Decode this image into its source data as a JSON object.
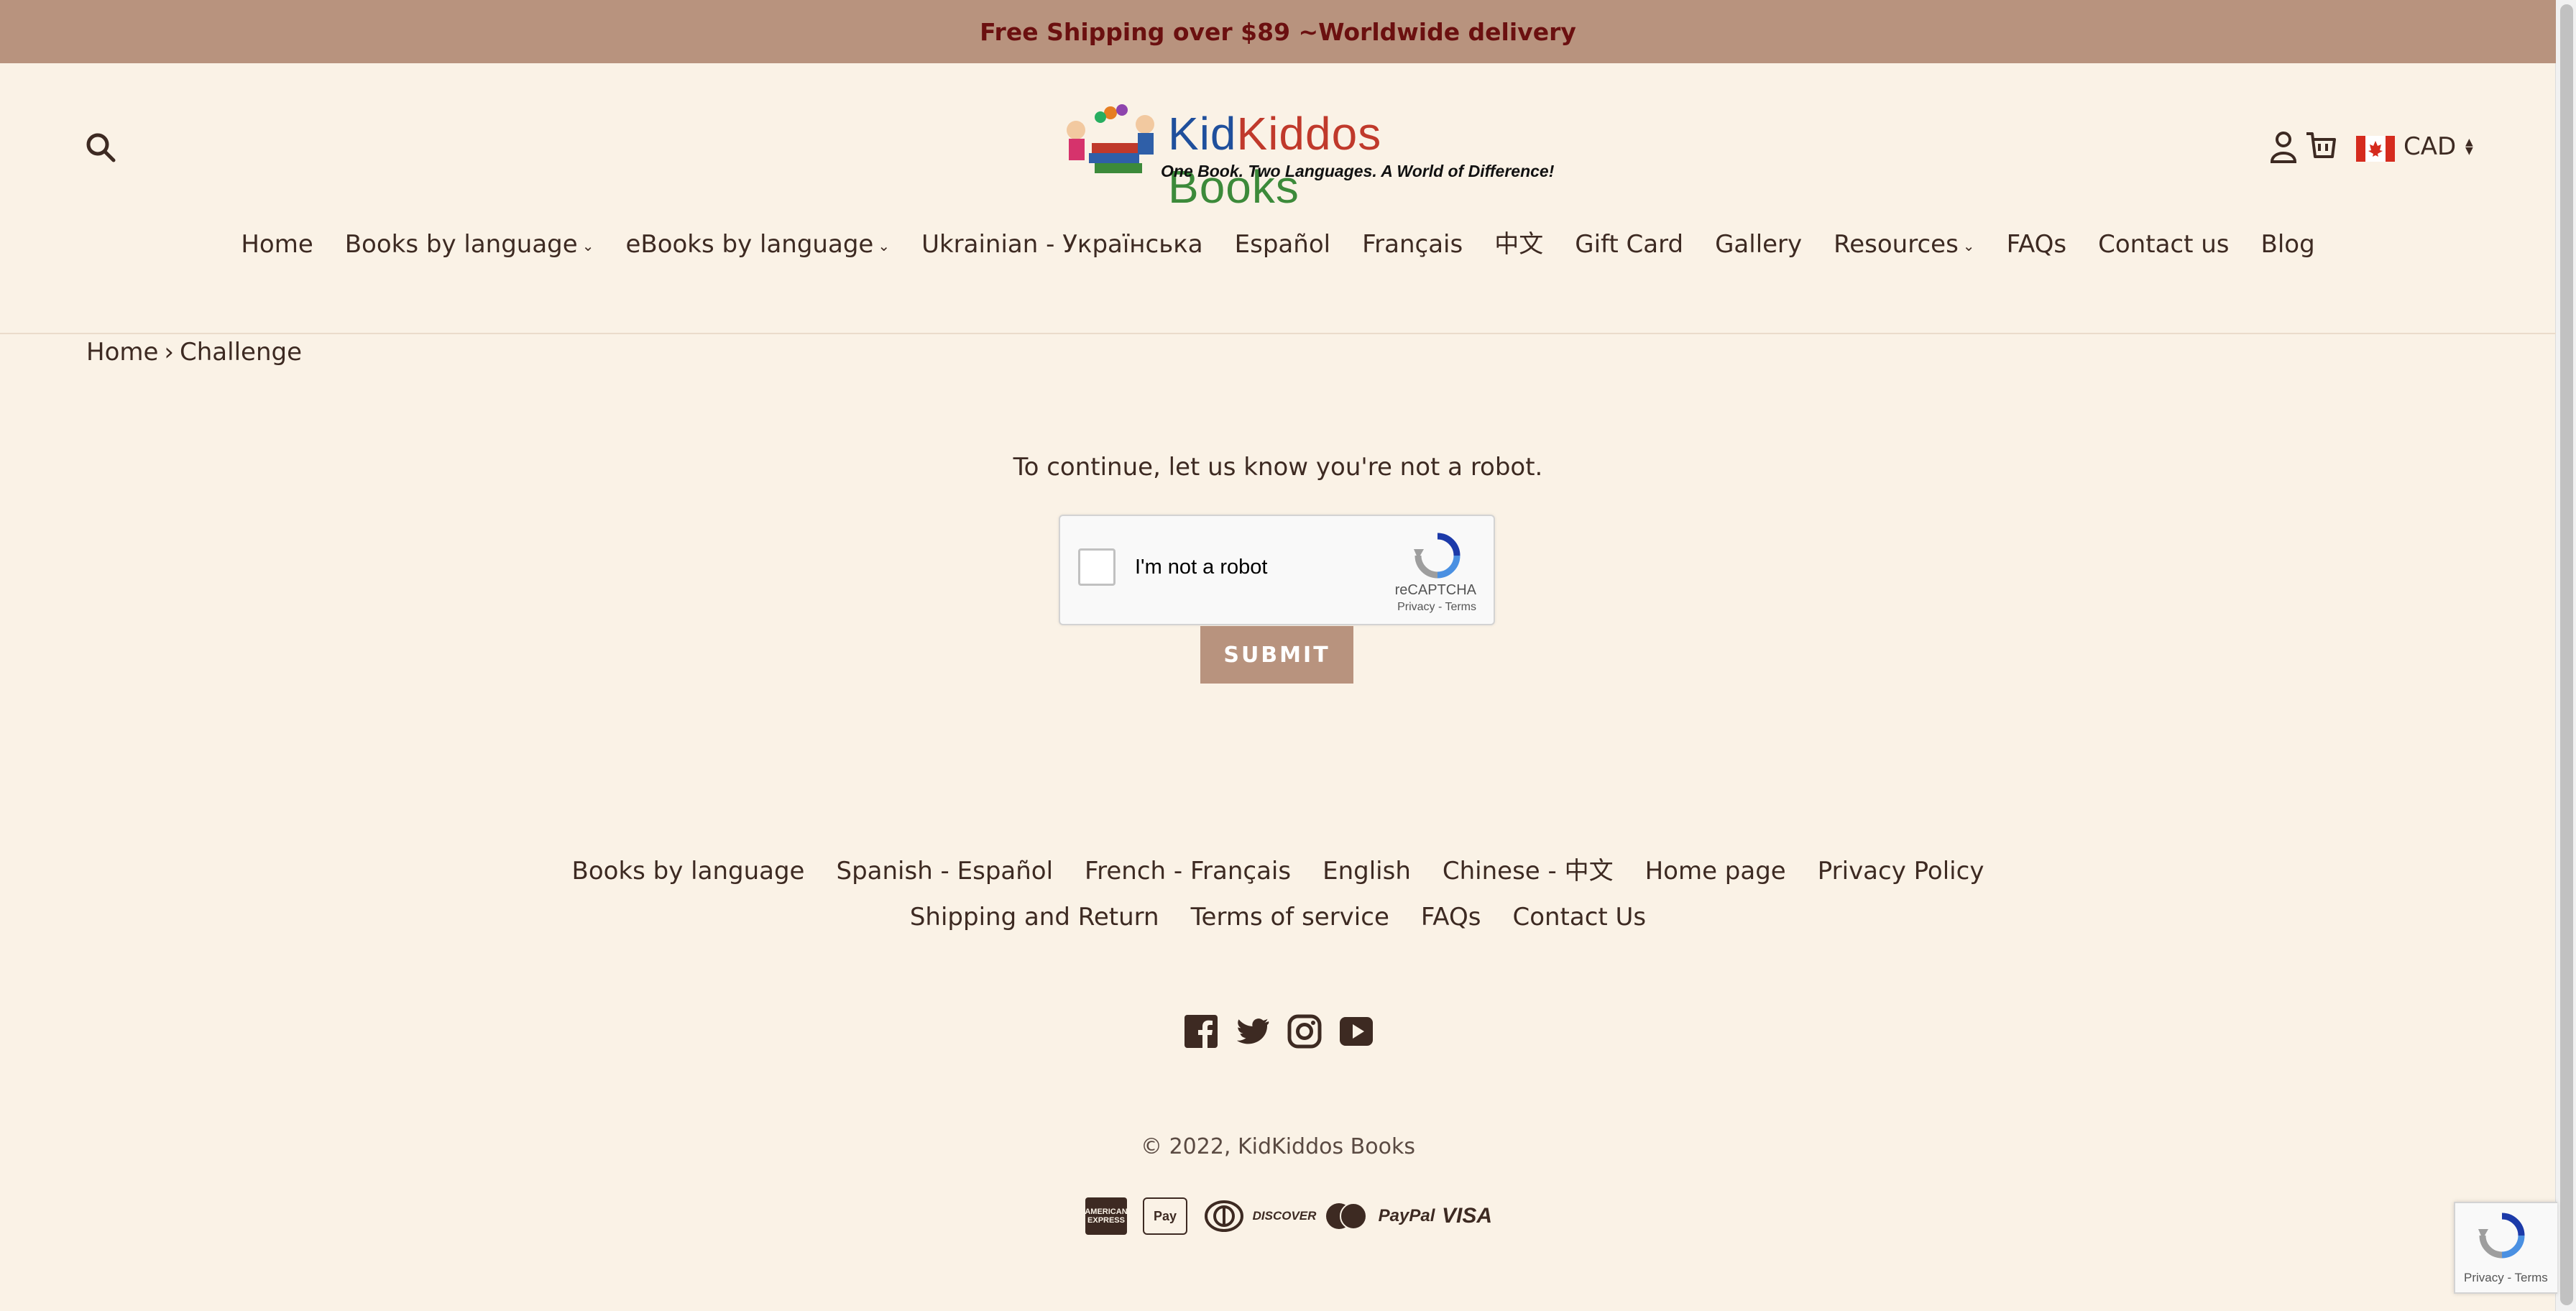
{
  "announcement": {
    "text": "Free Shipping over $89 ~Worldwide delivery"
  },
  "header": {
    "logo": {
      "title_part1": "Kid",
      "title_part2": "Kiddos",
      "title_part3": " Books",
      "tagline": "One Book. Two Languages. A World of Difference!"
    },
    "currency": "CAD"
  },
  "nav": {
    "items": [
      {
        "label": "Home"
      },
      {
        "label": "Books by language"
      },
      {
        "label": "eBooks by language"
      },
      {
        "label": "Ukrainian - Українська"
      },
      {
        "label": "Español"
      },
      {
        "label": "Français"
      },
      {
        "label": "中文"
      },
      {
        "label": "Gift Card"
      },
      {
        "label": "Gallery"
      },
      {
        "label": "Resources"
      },
      {
        "label": "FAQs"
      },
      {
        "label": "Contact us"
      },
      {
        "label": "Blog"
      }
    ]
  },
  "breadcrumb": {
    "home": "Home",
    "sep": "›",
    "current": "Challenge"
  },
  "challenge": {
    "message": "To continue, let us know you're not a robot.",
    "recaptcha_label": "I'm not a robot",
    "recaptcha_brand": "reCAPTCHA",
    "recaptcha_links": "Privacy - Terms",
    "submit_label": "SUBMIT"
  },
  "footer": {
    "links_row1": [
      "Books by language",
      "Spanish - Español",
      "French - Français",
      "English",
      "Chinese - 中文",
      "Home page",
      "Privacy Policy"
    ],
    "links_row2": [
      "Shipping and Return",
      "Terms of service",
      "FAQs",
      "Contact Us"
    ],
    "social": [
      "facebook-icon",
      "twitter-icon",
      "instagram-icon",
      "youtube-icon"
    ],
    "copyright_prefix": "© 2022, ",
    "copyright_link": "KidKiddos Books",
    "payments": {
      "amex": "AMERICAN EXPRESS",
      "apple": " Pay",
      "discover": "DISCOVER",
      "paypal": "PayPal",
      "visa": "VISA"
    }
  },
  "recaptcha_badge": {
    "links": "Privacy - Terms"
  },
  "colors": {
    "background": "#faf2e6",
    "announcement_bg": "#b8937e",
    "announcement_text": "#6b1010",
    "text": "#3d2a22",
    "button": "#b8937e"
  }
}
